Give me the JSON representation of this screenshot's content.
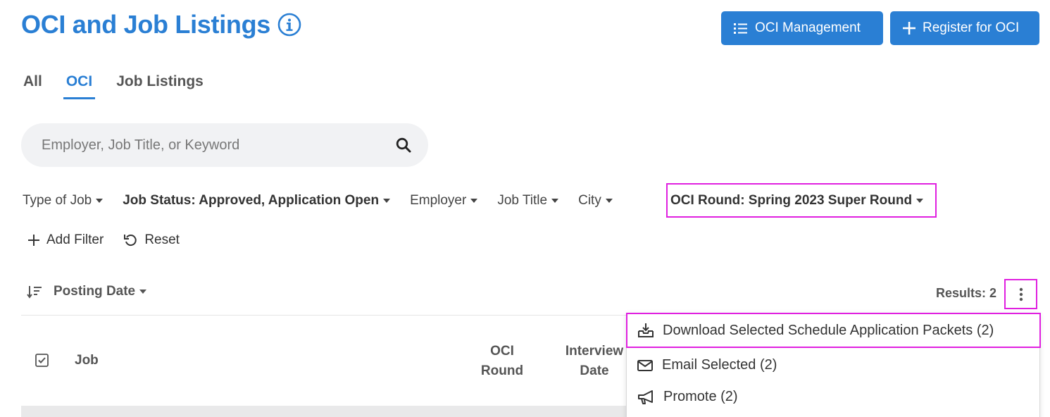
{
  "header": {
    "title": "OCI and Job Listings",
    "buttons": {
      "management_label": "OCI Management",
      "register_label": "Register for OCI"
    }
  },
  "tabs": [
    {
      "label": "All",
      "active": false
    },
    {
      "label": "OCI",
      "active": true
    },
    {
      "label": "Job Listings",
      "active": false
    }
  ],
  "search": {
    "placeholder": "Employer, Job Title, or Keyword",
    "value": ""
  },
  "filters": [
    {
      "label": "Type of Job",
      "bold": false
    },
    {
      "label": "Job Status: Approved, Application Open",
      "bold": true
    },
    {
      "label": "Employer",
      "bold": false
    },
    {
      "label": "Job Title",
      "bold": false
    },
    {
      "label": "City",
      "bold": false
    },
    {
      "label": "OCI Round: Spring 2023 Super Round",
      "bold": true
    }
  ],
  "actions": {
    "add_filter": "Add Filter",
    "reset": "Reset"
  },
  "sort": {
    "label": "Posting Date"
  },
  "results": {
    "text": "Results: 2"
  },
  "table": {
    "columns": {
      "job": "Job",
      "oci_round_line1": "OCI",
      "oci_round_line2": "Round",
      "interview_line1": "Interview",
      "interview_line2": "Date"
    }
  },
  "menu": {
    "items": [
      {
        "label": "Download Selected Schedule Application Packets (2)",
        "icon": "download-tray-icon"
      },
      {
        "label": "Email Selected (2)",
        "icon": "envelope-icon"
      },
      {
        "label": "Promote (2)",
        "icon": "megaphone-icon"
      }
    ]
  },
  "colors": {
    "accent": "#2a7fd4",
    "highlight": "#e020e0"
  }
}
